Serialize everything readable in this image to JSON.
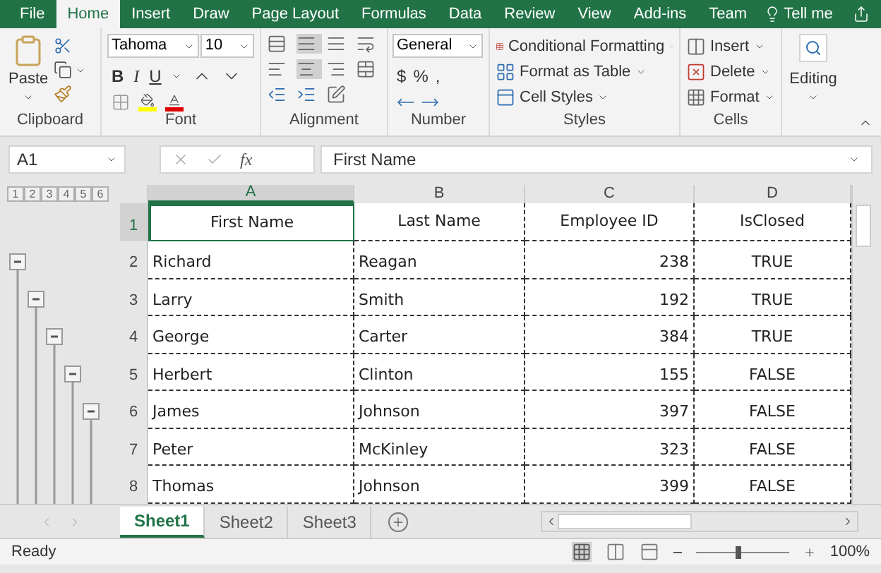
{
  "ribbon_tabs": [
    {
      "label": "File",
      "selected": false
    },
    {
      "label": "Home",
      "selected": true
    },
    {
      "label": "Insert",
      "selected": false
    },
    {
      "label": "Draw",
      "selected": false
    },
    {
      "label": "Page Layout",
      "selected": false
    },
    {
      "label": "Formulas",
      "selected": false
    },
    {
      "label": "Data",
      "selected": false
    },
    {
      "label": "Review",
      "selected": false
    },
    {
      "label": "View",
      "selected": false
    },
    {
      "label": "Add-ins",
      "selected": false
    },
    {
      "label": "Team",
      "selected": false
    }
  ],
  "tell_me": "Tell me",
  "ribbon": {
    "clipboard": {
      "paste": "Paste",
      "label": "Clipboard"
    },
    "font": {
      "name": "Tahoma",
      "size": "10",
      "bold": "B",
      "italic": "I",
      "underline": "U",
      "label": "Font"
    },
    "alignment": {
      "label": "Alignment"
    },
    "number": {
      "format": "General",
      "currency": "$",
      "percent": "%",
      "comma": ",",
      "label": "Number"
    },
    "styles": {
      "items": [
        "Conditional Formatting",
        "Format as Table",
        "Cell Styles"
      ],
      "label": "Styles"
    },
    "cells": {
      "items": [
        "Insert",
        "Delete",
        "Format"
      ],
      "label": "Cells"
    },
    "editing": {
      "label": "Editing"
    }
  },
  "formula_bar": {
    "name_box": "A1",
    "fx": "fx",
    "value": "First Name"
  },
  "outline_levels": [
    "1",
    "2",
    "3",
    "4",
    "5",
    "6"
  ],
  "outline_groups": [
    {
      "expanded": true
    },
    {
      "expanded": true
    },
    {
      "expanded": true
    },
    {
      "expanded": true
    },
    {
      "expanded": true
    }
  ],
  "columns": [
    {
      "label": "A",
      "selected": true
    },
    {
      "label": "B",
      "selected": false
    },
    {
      "label": "C",
      "selected": false
    },
    {
      "label": "D",
      "selected": false
    }
  ],
  "rows": [
    {
      "number": "1",
      "selected": true,
      "cells": [
        "First Name",
        "Last Name",
        "Employee ID",
        "IsClosed"
      ]
    },
    {
      "number": "2",
      "selected": false,
      "cells": [
        "Richard",
        "Reagan",
        "238",
        "TRUE"
      ]
    },
    {
      "number": "3",
      "selected": false,
      "cells": [
        "Larry",
        "Smith",
        "192",
        "TRUE"
      ]
    },
    {
      "number": "4",
      "selected": false,
      "cells": [
        "George",
        "Carter",
        "384",
        "TRUE"
      ]
    },
    {
      "number": "5",
      "selected": false,
      "cells": [
        "Herbert",
        "Clinton",
        "155",
        "FALSE"
      ]
    },
    {
      "number": "6",
      "selected": false,
      "cells": [
        "James",
        "Johnson",
        "397",
        "FALSE"
      ]
    },
    {
      "number": "7",
      "selected": false,
      "cells": [
        "Peter",
        "McKinley",
        "323",
        "FALSE"
      ]
    },
    {
      "number": "8",
      "selected": false,
      "cells": [
        "Thomas",
        "Johnson",
        "399",
        "FALSE"
      ]
    }
  ],
  "sheets": [
    {
      "label": "Sheet1",
      "selected": true
    },
    {
      "label": "Sheet2",
      "selected": false
    },
    {
      "label": "Sheet3",
      "selected": false
    }
  ],
  "status": "Ready",
  "zoom": {
    "level": 0.45,
    "reading": "100%"
  }
}
